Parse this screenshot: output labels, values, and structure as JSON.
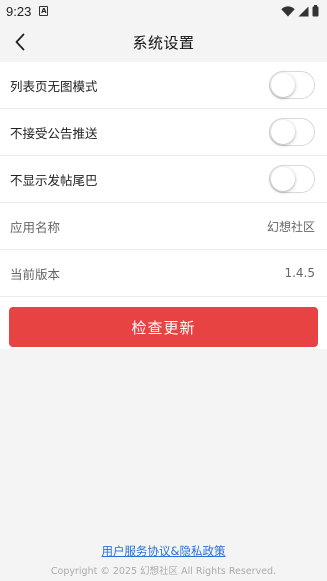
{
  "status_bar": {
    "time": "9:23",
    "notif_icon": "A"
  },
  "header": {
    "title": "系统设置",
    "back_icon": "chevron-left-icon"
  },
  "settings": {
    "toggles": [
      {
        "label": "列表页无图模式",
        "on": false
      },
      {
        "label": "不接受公告推送",
        "on": false
      },
      {
        "label": "不显示发帖尾巴",
        "on": false
      }
    ],
    "app_name": {
      "label": "应用名称",
      "value": "幻想社区"
    },
    "version": {
      "label": "当前版本",
      "value": "1.4.5"
    }
  },
  "check_update": {
    "label": "检查更新",
    "color": "#e84343"
  },
  "footer": {
    "policy_link": "用户服务协议&隐私政策",
    "copyright": "Copyright © 2025 幻想社区 All Rights Reserved."
  }
}
